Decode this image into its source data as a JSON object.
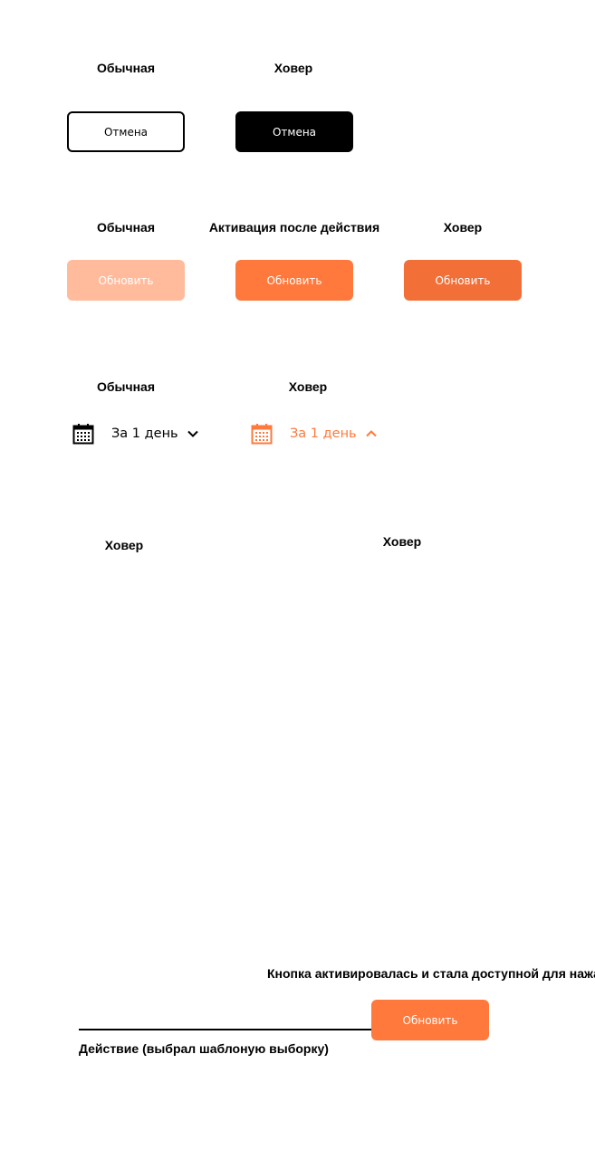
{
  "colors": {
    "accent": "#ff783c",
    "accent_hover": "#f26f38",
    "accent_disabled": "#ffbb9c",
    "dark": "#000000"
  },
  "section_cancel": {
    "label_normal": "Обычная",
    "label_hover": "Ховер",
    "button_label": "Отмена"
  },
  "section_update": {
    "label_normal": "Обычная",
    "label_activated": "Активация после действия",
    "label_hover": "Ховер",
    "button_label": "Обновить"
  },
  "section_period": {
    "label_normal": "Обычная",
    "label_hover": "Ховер",
    "period_label": "За 1 день",
    "icons": [
      "calendar-icon",
      "chevron-down-icon",
      "chevron-up-icon"
    ]
  },
  "section_empty": {
    "label_hover_left": "Ховер",
    "label_hover_right": "Ховер"
  },
  "section_action": {
    "caption": "Кнопка активировалась и стала доступной для нажатия",
    "button_label": "Обновить",
    "action_label": "Действие (выбрал шаблоную выборку)"
  }
}
